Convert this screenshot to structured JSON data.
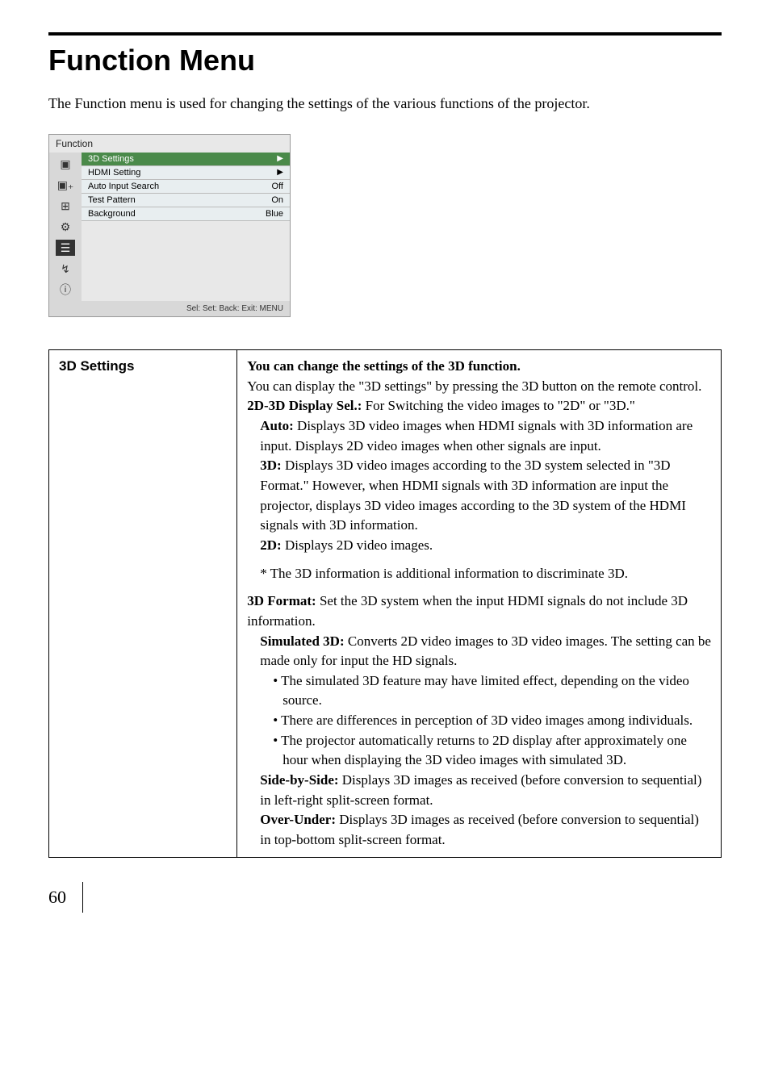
{
  "page": {
    "title": "Function Menu",
    "intro": "The Function menu is used for changing the settings of the various functions of the projector.",
    "page_number": "60"
  },
  "menu_screenshot": {
    "title": "Function",
    "rows": [
      {
        "label": "3D Settings",
        "value": "",
        "arrow": "▶",
        "highlight": true
      },
      {
        "label": "HDMI Setting",
        "value": "",
        "arrow": "▶",
        "highlight": false
      },
      {
        "label": "Auto Input Search",
        "value": "Off",
        "arrow": "",
        "highlight": false
      },
      {
        "label": "Test Pattern",
        "value": "On",
        "arrow": "",
        "highlight": false
      },
      {
        "label": "Background",
        "value": "Blue",
        "arrow": "",
        "highlight": false
      }
    ],
    "footer": "Sel:  Set:  Back:  Exit: MENU"
  },
  "table": {
    "row_label": "3D Settings",
    "head": "You can change the settings of the 3D function.",
    "line1": "You can display the \"3D settings\" by pressing the 3D button on the remote control.",
    "disp_sel_label": "2D-3D Display Sel.:",
    "disp_sel_text": " For Switching the video images to \"2D\" or \"3D.\"",
    "auto_label": "Auto:",
    "auto_text": " Displays 3D video images when HDMI signals with 3D information are input. Displays 2D video images when other signals are input.",
    "threeD_label": "3D:",
    "threeD_text": " Displays 3D video images according to the 3D system selected in \"3D Format.\" However, when HDMI signals with 3D information are input the projector, displays 3D video images according to the 3D system of the HDMI signals with 3D information.",
    "twoD_label": "2D:",
    "twoD_text": " Displays 2D video images.",
    "note": "* The 3D information is additional information to discriminate 3D.",
    "format_label": "3D Format:",
    "format_text": " Set the 3D system when the input HDMI signals do not include 3D information.",
    "sim_label": "Simulated 3D:",
    "sim_text": " Converts 2D video images to 3D video images. The setting can be made only for input the HD signals.",
    "bullet1": "• The simulated 3D feature may have limited effect, depending on the video source.",
    "bullet2": "• There are differences in perception of 3D video images among individuals.",
    "bullet3": "• The projector automatically returns to 2D display after approximately one hour when displaying the 3D video images with simulated 3D.",
    "sbs_label": "Side-by-Side:",
    "sbs_text": " Displays 3D images as received (before conversion to sequential) in left-right split-screen format.",
    "ou_label": "Over-Under:",
    "ou_text": " Displays 3D images as received (before conversion to sequential) in top-bottom split-screen format."
  }
}
